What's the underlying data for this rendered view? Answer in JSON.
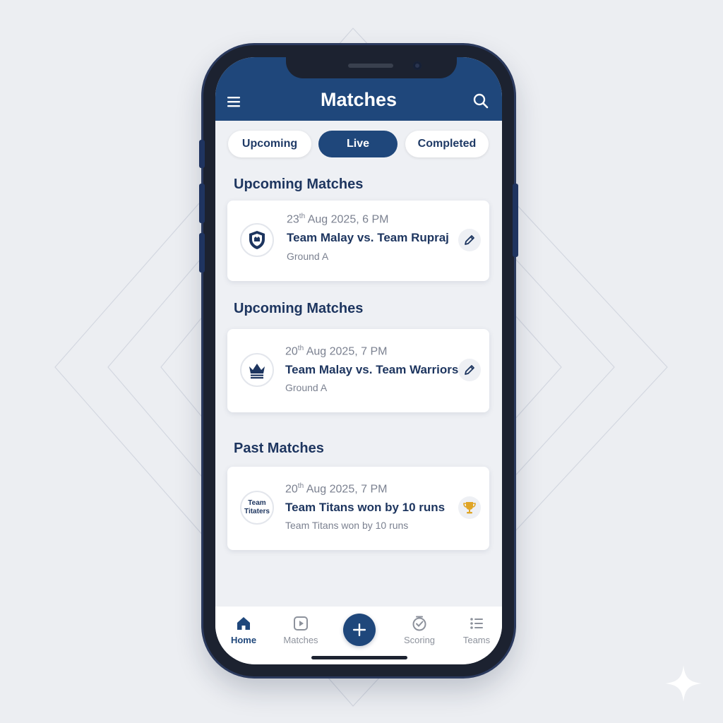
{
  "header": {
    "title": "Matches"
  },
  "tabs": [
    {
      "label": "Upcoming",
      "active": false
    },
    {
      "label": "Live",
      "active": true
    },
    {
      "label": "Completed",
      "active": false
    }
  ],
  "sections": [
    {
      "title": "Upcoming Matches",
      "cards": [
        {
          "icon": "shield-icon",
          "date_day": "23",
          "date_suffix": "th",
          "date_rest": " Aug 2025, 6 PM",
          "title": "Team Malay vs. Team Rupraj",
          "subtitle": "Ground A",
          "action": "edit-icon"
        }
      ]
    },
    {
      "title": "Upcoming Matches",
      "cards": [
        {
          "icon": "crown-icon",
          "date_day": "20",
          "date_suffix": "th",
          "date_rest": " Aug 2025, 7 PM",
          "title": "Team Malay vs. Team Warriors",
          "subtitle": "Ground A",
          "action": "edit-icon"
        }
      ]
    },
    {
      "title": "Past Matches",
      "cards": [
        {
          "icon_text_line1": "Team",
          "icon_text_line2": "Titaters",
          "date_day": "20",
          "date_suffix": "th",
          "date_rest": " Aug 2025, 7 PM",
          "title": "Team Titans won by 10 runs",
          "subtitle": "Team Titans won by 10 runs",
          "action": "trophy-icon"
        }
      ]
    }
  ],
  "bottom_nav": [
    {
      "label": "Home",
      "icon": "home-icon",
      "active": true
    },
    {
      "label": "Matches",
      "icon": "matches-icon",
      "active": false
    },
    {
      "label": "Scoring",
      "icon": "scoring-icon",
      "active": false
    },
    {
      "label": "Teams",
      "icon": "teams-icon",
      "active": false
    }
  ],
  "colors": {
    "primary": "#1f477b",
    "background": "#eef0f4",
    "text_dark": "#1d355f",
    "text_muted": "#7b8190",
    "trophy": "#e0a526"
  }
}
